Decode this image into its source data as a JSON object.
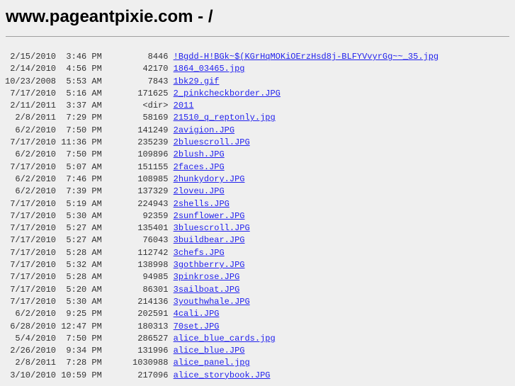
{
  "title": "www.pageantpixie.com - /",
  "entries": [
    {
      "date": "2/15/2010",
      "time": "3:46 PM",
      "size": "8446",
      "name": "!Bgdd-H!BGk~$(KGrHqMOKiOErzHsd8j-BLFYVvyrGg~~_35.jpg"
    },
    {
      "date": "2/14/2010",
      "time": "4:56 PM",
      "size": "42170",
      "name": "1864_03465.jpg"
    },
    {
      "date": "10/23/2008",
      "time": "5:53 AM",
      "size": "7843",
      "name": "1bk29.gif"
    },
    {
      "date": "7/17/2010",
      "time": "5:16 AM",
      "size": "171625",
      "name": "2_pinkcheckborder.JPG"
    },
    {
      "date": "2/11/2011",
      "time": "3:37 AM",
      "size": "<dir>",
      "name": "2011"
    },
    {
      "date": "2/8/2011",
      "time": "7:29 PM",
      "size": "58169",
      "name": "21510_q_reptonly.jpg"
    },
    {
      "date": "6/2/2010",
      "time": "7:50 PM",
      "size": "141249",
      "name": "2avigion.JPG"
    },
    {
      "date": "7/17/2010",
      "time": "11:36 PM",
      "size": "235239",
      "name": "2bluescroll.JPG"
    },
    {
      "date": "6/2/2010",
      "time": "7:50 PM",
      "size": "109896",
      "name": "2blush.JPG"
    },
    {
      "date": "7/17/2010",
      "time": "5:07 AM",
      "size": "151155",
      "name": "2faces.JPG"
    },
    {
      "date": "6/2/2010",
      "time": "7:46 PM",
      "size": "108985",
      "name": "2hunkydory.JPG"
    },
    {
      "date": "6/2/2010",
      "time": "7:39 PM",
      "size": "137329",
      "name": "2loveu.JPG"
    },
    {
      "date": "7/17/2010",
      "time": "5:19 AM",
      "size": "224943",
      "name": "2shells.JPG"
    },
    {
      "date": "7/17/2010",
      "time": "5:30 AM",
      "size": "92359",
      "name": "2sunflower.JPG"
    },
    {
      "date": "7/17/2010",
      "time": "5:27 AM",
      "size": "135401",
      "name": "3bluescroll.JPG"
    },
    {
      "date": "7/17/2010",
      "time": "5:27 AM",
      "size": "76043",
      "name": "3buildbear.JPG"
    },
    {
      "date": "7/17/2010",
      "time": "5:28 AM",
      "size": "112742",
      "name": "3chefs.JPG"
    },
    {
      "date": "7/17/2010",
      "time": "5:32 AM",
      "size": "138998",
      "name": "3gothberry.JPG"
    },
    {
      "date": "7/17/2010",
      "time": "5:28 AM",
      "size": "94985",
      "name": "3pinkrose.JPG"
    },
    {
      "date": "7/17/2010",
      "time": "5:20 AM",
      "size": "86301",
      "name": "3sailboat.JPG"
    },
    {
      "date": "7/17/2010",
      "time": "5:30 AM",
      "size": "214136",
      "name": "3youthwhale.JPG"
    },
    {
      "date": "6/2/2010",
      "time": "9:25 PM",
      "size": "202591",
      "name": "4cali.JPG"
    },
    {
      "date": "6/28/2010",
      "time": "12:47 PM",
      "size": "180313",
      "name": "70set.JPG"
    },
    {
      "date": "5/4/2010",
      "time": "7:50 PM",
      "size": "286527",
      "name": "alice_blue_cards.jpg"
    },
    {
      "date": "2/26/2010",
      "time": "9:34 PM",
      "size": "131996",
      "name": "alice_blue.JPG"
    },
    {
      "date": "2/8/2011",
      "time": "7:28 PM",
      "size": "1030988",
      "name": "alice_panel.jpg"
    },
    {
      "date": "3/10/2010",
      "time": "10:59 PM",
      "size": "217096",
      "name": "alice_storybook.JPG"
    }
  ]
}
